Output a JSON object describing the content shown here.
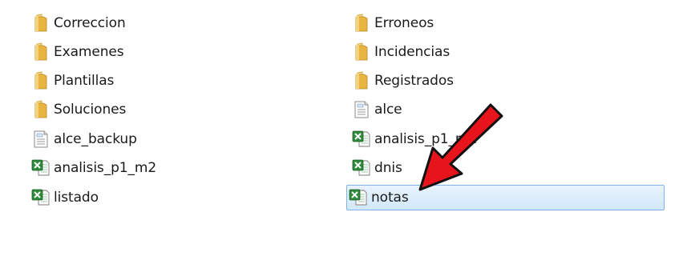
{
  "file_list": {
    "left_column": [
      {
        "name": "Correccion",
        "type": "folder"
      },
      {
        "name": "Examenes",
        "type": "folder"
      },
      {
        "name": "Plantillas",
        "type": "folder"
      },
      {
        "name": "Soluciones",
        "type": "folder"
      },
      {
        "name": "alce_backup",
        "type": "text"
      },
      {
        "name": "analisis_p1_m2",
        "type": "excel"
      },
      {
        "name": "listado",
        "type": "excel"
      }
    ],
    "right_column": [
      {
        "name": "Erroneos",
        "type": "folder"
      },
      {
        "name": "Incidencias",
        "type": "folder"
      },
      {
        "name": "Registrados",
        "type": "folder"
      },
      {
        "name": "alce",
        "type": "text"
      },
      {
        "name": "analisis_p1_m1",
        "type": "excel"
      },
      {
        "name": "dnis",
        "type": "excel"
      },
      {
        "name": "notas",
        "type": "excel",
        "selected": true
      }
    ]
  },
  "annotation": {
    "arrow_icon": "red-arrow-icon",
    "color": "#e8141b"
  },
  "colors": {
    "selection_bg": "#d9ebfb",
    "selection_border": "#7eb4ea",
    "folder": "#e6b840",
    "excel": "#2f8a3c"
  }
}
